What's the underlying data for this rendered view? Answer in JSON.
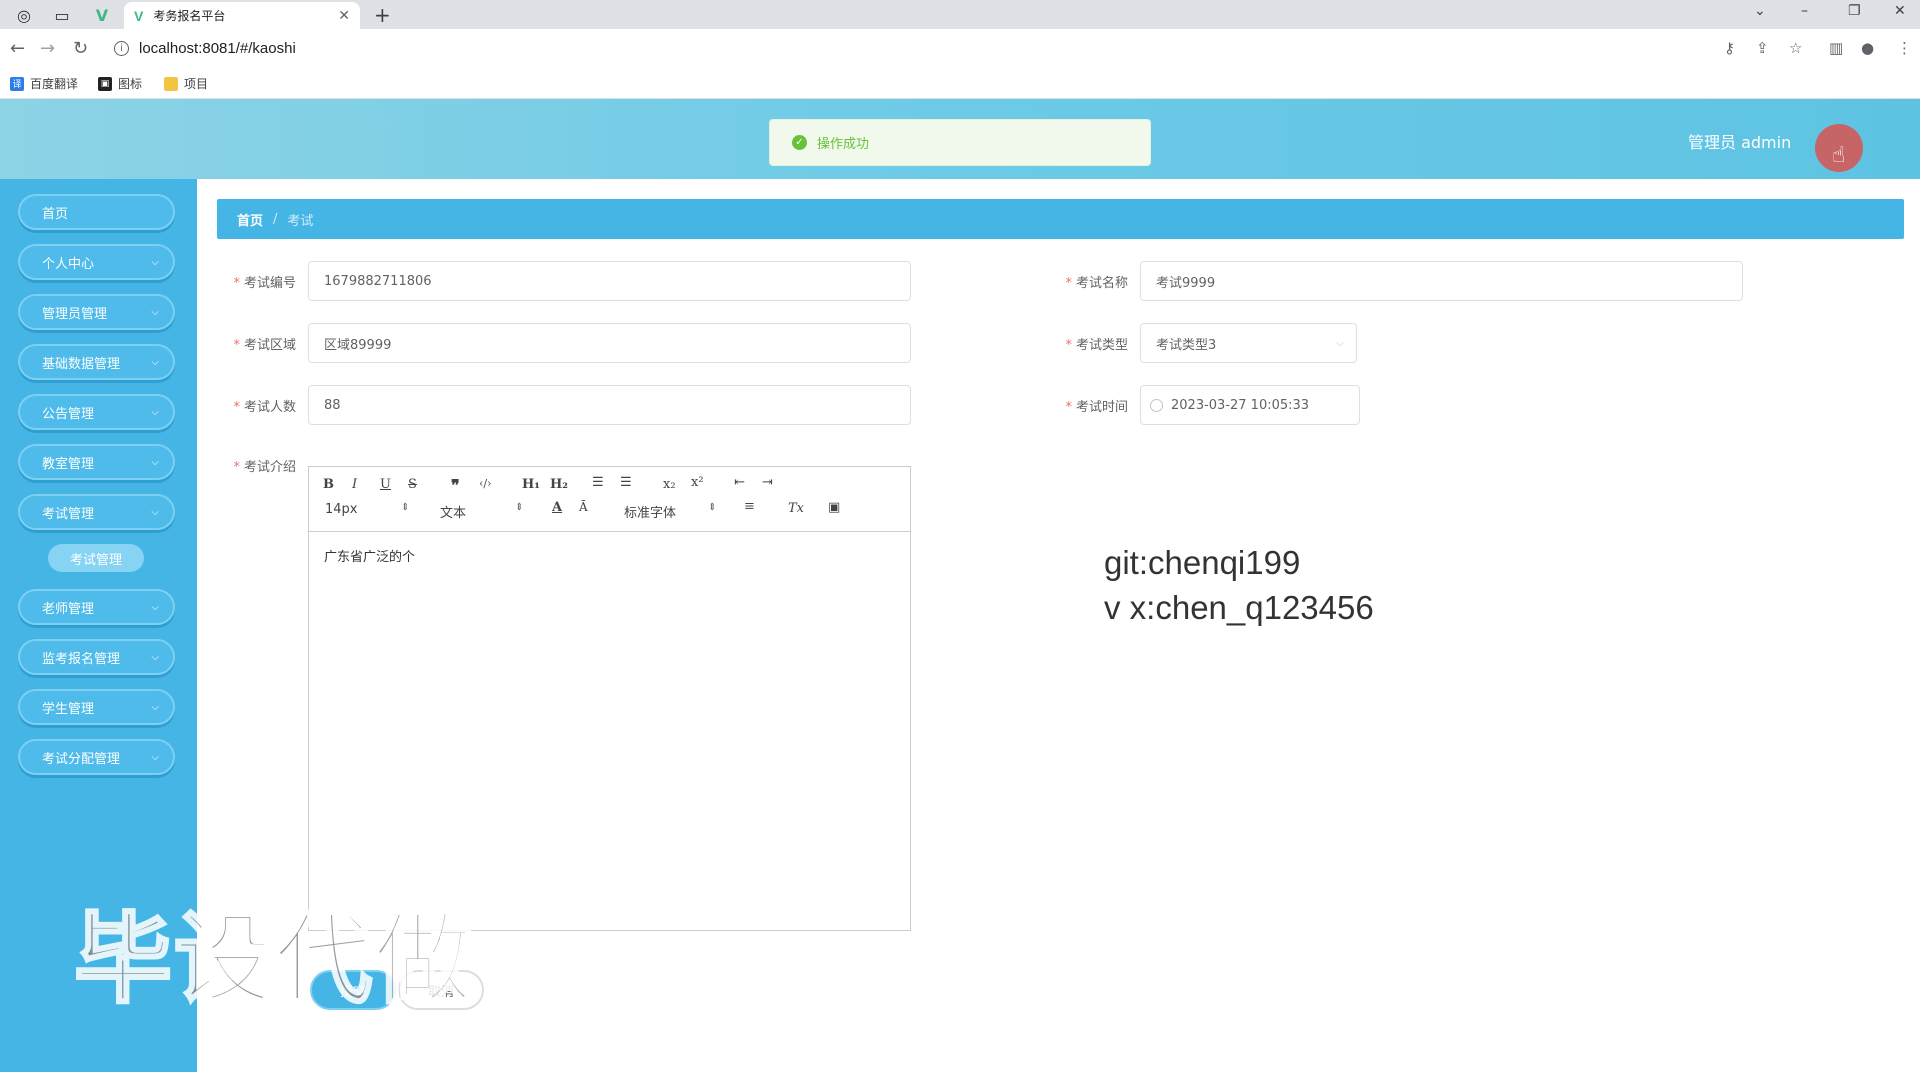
{
  "browser": {
    "tab_title": "考务报名平台",
    "url": "localhost:8081/#/kaoshi",
    "bookmarks": [
      "百度翻译",
      "图标",
      "项目"
    ]
  },
  "header": {
    "toast": "操作成功",
    "user": "管理员 admin"
  },
  "sidebar": {
    "items": [
      "首页",
      "个人中心",
      "管理员管理",
      "基础数据管理",
      "公告管理",
      "教室管理",
      "考试管理",
      "老师管理",
      "监考报名管理",
      "学生管理",
      "考试分配管理"
    ],
    "sub_item": "考试管理"
  },
  "breadcrumb": {
    "home": "首页",
    "sep": "/",
    "current": "考试"
  },
  "form": {
    "exam_no_label": "考试编号",
    "exam_no": "1679882711806",
    "exam_name_label": "考试名称",
    "exam_name": "考试9999",
    "exam_area_label": "考试区域",
    "exam_area": "区域89999",
    "exam_type_label": "考试类型",
    "exam_type": "考试类型3",
    "exam_count_label": "考试人数",
    "exam_count": "88",
    "exam_time_label": "考试时间",
    "exam_time": "2023-03-27 10:05:33",
    "exam_intro_label": "考试介绍"
  },
  "editor": {
    "size": "14px",
    "header": "文本",
    "font": "标准字体",
    "content": "广东省广泛的个"
  },
  "overlay": {
    "git": "git:chenqi199",
    "vx": "v x:chen_q123456",
    "big": "毕设代做"
  },
  "buttons": {
    "submit": "提交",
    "cancel": "取消"
  }
}
